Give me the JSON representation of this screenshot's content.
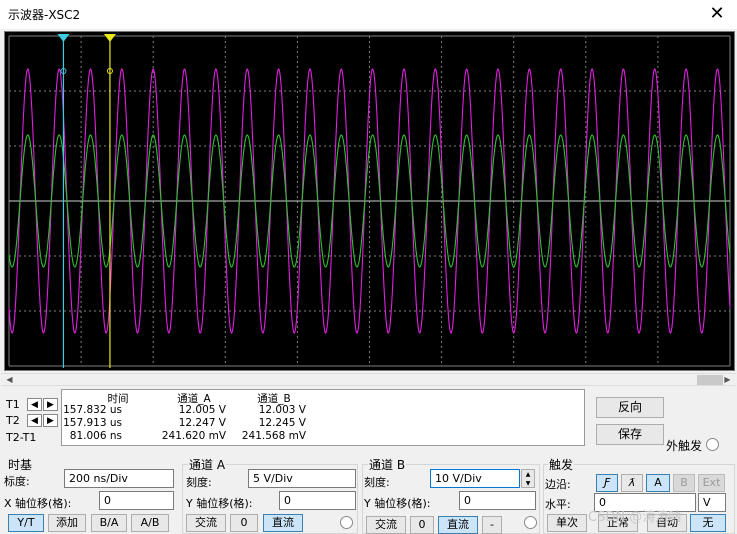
{
  "window": {
    "title": "示波器-XSC2",
    "close_glyph": "✕"
  },
  "screen": {
    "grid_color": "#7f7f7f",
    "channel_a_color": "#e020e0",
    "channel_b_color": "#30c030",
    "t1_cursor_color": "#3ecbe0",
    "t2_cursor_color": "#e8e81a"
  },
  "readout": {
    "rows": [
      {
        "label": "T1"
      },
      {
        "label": "T2"
      },
      {
        "label": "T2-T1"
      }
    ],
    "headers": {
      "time": "时间",
      "channel_a": "通道_A",
      "channel_b": "通道_B"
    },
    "values": [
      {
        "time": "157.832 us",
        "channel_a": "12.005 V",
        "channel_b": "12.003 V"
      },
      {
        "time": "157.913 us",
        "channel_a": "12.247 V",
        "channel_b": "12.245 V"
      },
      {
        "time": "81.006 ns",
        "channel_a": "241.620 mV",
        "channel_b": "241.568 mV"
      }
    ]
  },
  "side_buttons": {
    "reverse": "反向",
    "save": "保存"
  },
  "ext_trigger": {
    "label": "外触发"
  },
  "timebase": {
    "title": "时基",
    "scale_label": "标度:",
    "scale_value": "200 ns/Div",
    "xpos_label": "X 轴位移(格):",
    "xpos_value": "0",
    "buttons": [
      "Y/T",
      "添加",
      "B/A",
      "A/B"
    ]
  },
  "channel_a": {
    "title": "通道 A",
    "scale_label": "刻度:",
    "scale_value": "5  V/Div",
    "ypos_label": "Y 轴位移(格):",
    "ypos_value": "0",
    "buttons": [
      "交流",
      "0",
      "直流"
    ]
  },
  "channel_b": {
    "title": "通道 B",
    "scale_label": "刻度:",
    "scale_value": "10  V/Div",
    "ypos_label": "Y 轴位移(格):",
    "ypos_value": "0",
    "buttons": [
      "交流",
      "0",
      "直流",
      "-"
    ]
  },
  "trigger": {
    "title": "触发",
    "edge_label": "边沿:",
    "edge_buttons": [
      "Ƒ",
      "ƛ",
      "A",
      "B",
      "Ext"
    ],
    "level_label": "水平:",
    "level_value": "0",
    "level_unit": "V",
    "mode_buttons": [
      "单次",
      "正常",
      "自动",
      "无"
    ]
  },
  "watermark": "CSDN @涛涛呐"
}
